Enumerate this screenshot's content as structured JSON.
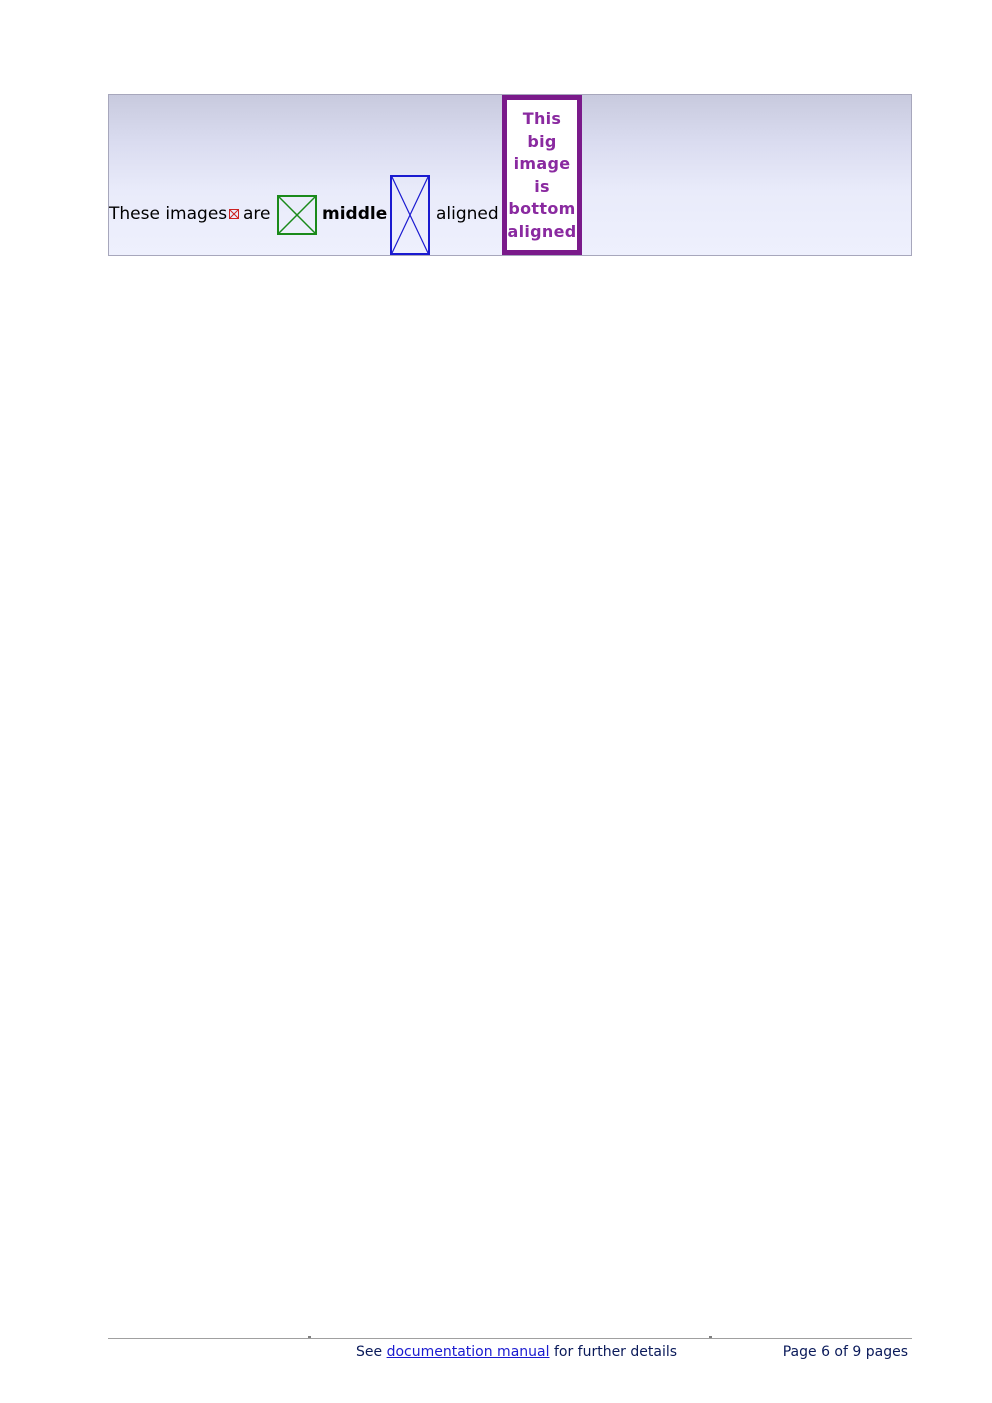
{
  "box": {
    "text_before_small": "These images",
    "text_after_small": "are",
    "text_bold": "middle",
    "text_after_tall": "aligned",
    "big_image_lines": [
      "This",
      "big",
      "image",
      "is",
      "bottom",
      "aligned"
    ],
    "colors": {
      "small_image": "#cc2222",
      "green_image": "#1a8a1a",
      "blue_image": "#1a1ad0",
      "purple_image": "#7a1a8a"
    }
  },
  "footer": {
    "see": "See",
    "link": "documentation manual",
    "after_link": "for further details",
    "page": "Page 6 of 9 pages"
  }
}
